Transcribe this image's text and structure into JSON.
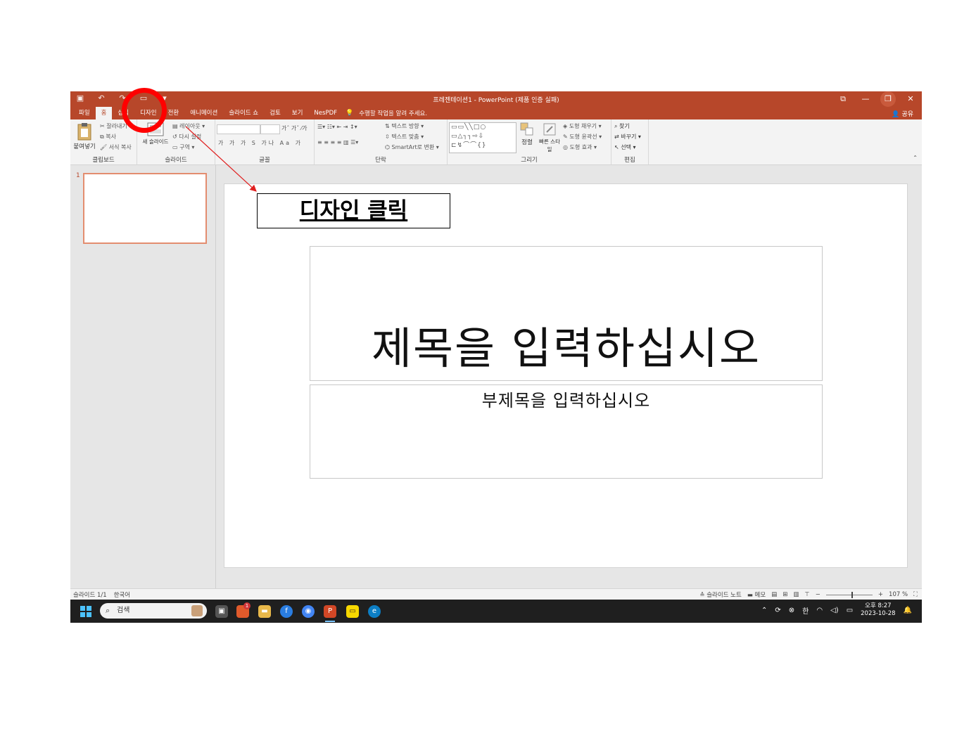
{
  "window": {
    "title": "프레젠테이션1 - PowerPoint (제품 인증 실패)",
    "controls": [
      "⧉",
      "—",
      "❐",
      "✕"
    ]
  },
  "tabs": [
    {
      "label": "파일"
    },
    {
      "label": "홈"
    },
    {
      "label": "삽입"
    },
    {
      "label": "디자인"
    },
    {
      "label": "전환"
    },
    {
      "label": "애니메이션"
    },
    {
      "label": "슬라이드 쇼"
    },
    {
      "label": "검토"
    },
    {
      "label": "보기"
    },
    {
      "label": "NesPDF"
    }
  ],
  "tell_me": "수행할 작업을 알려 주세요.",
  "share": "공유",
  "ribbon": {
    "clipboard": {
      "label": "클립보드",
      "paste": "붙여넣기",
      "cut": "잘라내기",
      "copy": "복사",
      "format_painter": "서식 복사"
    },
    "slides": {
      "label": "슬라이드",
      "new_slide": "새 슬라이드",
      "layout": "레이아웃",
      "reset": "다시 설정",
      "section": "구역"
    },
    "font": {
      "label": "글꼴",
      "bold": "가",
      "italic": "가",
      "underline": "가",
      "shadow": "S",
      "spacing": "가나",
      "case": "Aa",
      "color": "가"
    },
    "paragraph": {
      "label": "단락",
      "text_direction": "텍스트 방향",
      "align_text": "텍스트 맞춤",
      "smartart": "SmartArt로 변환"
    },
    "drawing": {
      "label": "그리기",
      "arrange": "정렬",
      "quick_styles": "빠른 스타일",
      "shape_fill": "도형 채우기",
      "shape_outline": "도형 윤곽선",
      "shape_effects": "도형 효과"
    },
    "editing": {
      "label": "편집",
      "find": "찾기",
      "replace": "바꾸기",
      "select": "선택"
    }
  },
  "slides_panel": {
    "slide_number": "1"
  },
  "slide": {
    "title_placeholder": "제목을 입력하십시오",
    "subtitle_placeholder": "부제목을 입력하십시오"
  },
  "statusbar": {
    "slide_info": "슬라이드 1/1",
    "language": "한국어",
    "notes": "슬라이드 노트",
    "comments": "메모",
    "zoom": "107 %",
    "zoom_level": 0.57
  },
  "taskbar": {
    "search_placeholder": "검색",
    "notification_badge": "1",
    "ime": "한",
    "clock_time": "오후 8:27",
    "clock_date": "2023-10-28"
  },
  "annotation": {
    "callout_text": "디자인 클릭",
    "color": "#ff0000"
  },
  "colors": {
    "accent": "#b7472a",
    "ribbon_bg": "#f3f3f3",
    "taskbar_bg": "#1f1f1f"
  }
}
